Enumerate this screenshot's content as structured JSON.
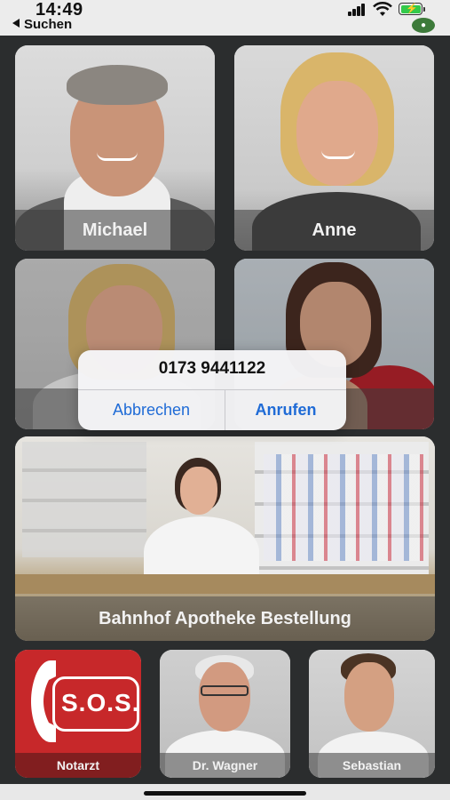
{
  "status_bar": {
    "time": "14:49",
    "back_label": "Suchen"
  },
  "contacts": [
    {
      "name": "Michael"
    },
    {
      "name": "Anne"
    },
    {
      "name": ""
    },
    {
      "name": ""
    },
    {
      "name": "Bahnhof Apotheke Bestellung"
    },
    {
      "name": "Notarzt"
    },
    {
      "name": "Dr. Wagner"
    },
    {
      "name": "Sebastian"
    }
  ],
  "sos": {
    "text": "S.O.S."
  },
  "alert": {
    "phone_number": "0173 9441122",
    "cancel_label": "Abbrechen",
    "call_label": "Anrufen"
  },
  "colors": {
    "accent": "#1f6bd6",
    "sos_red": "#c7282a",
    "background": "#2b2d2e"
  }
}
